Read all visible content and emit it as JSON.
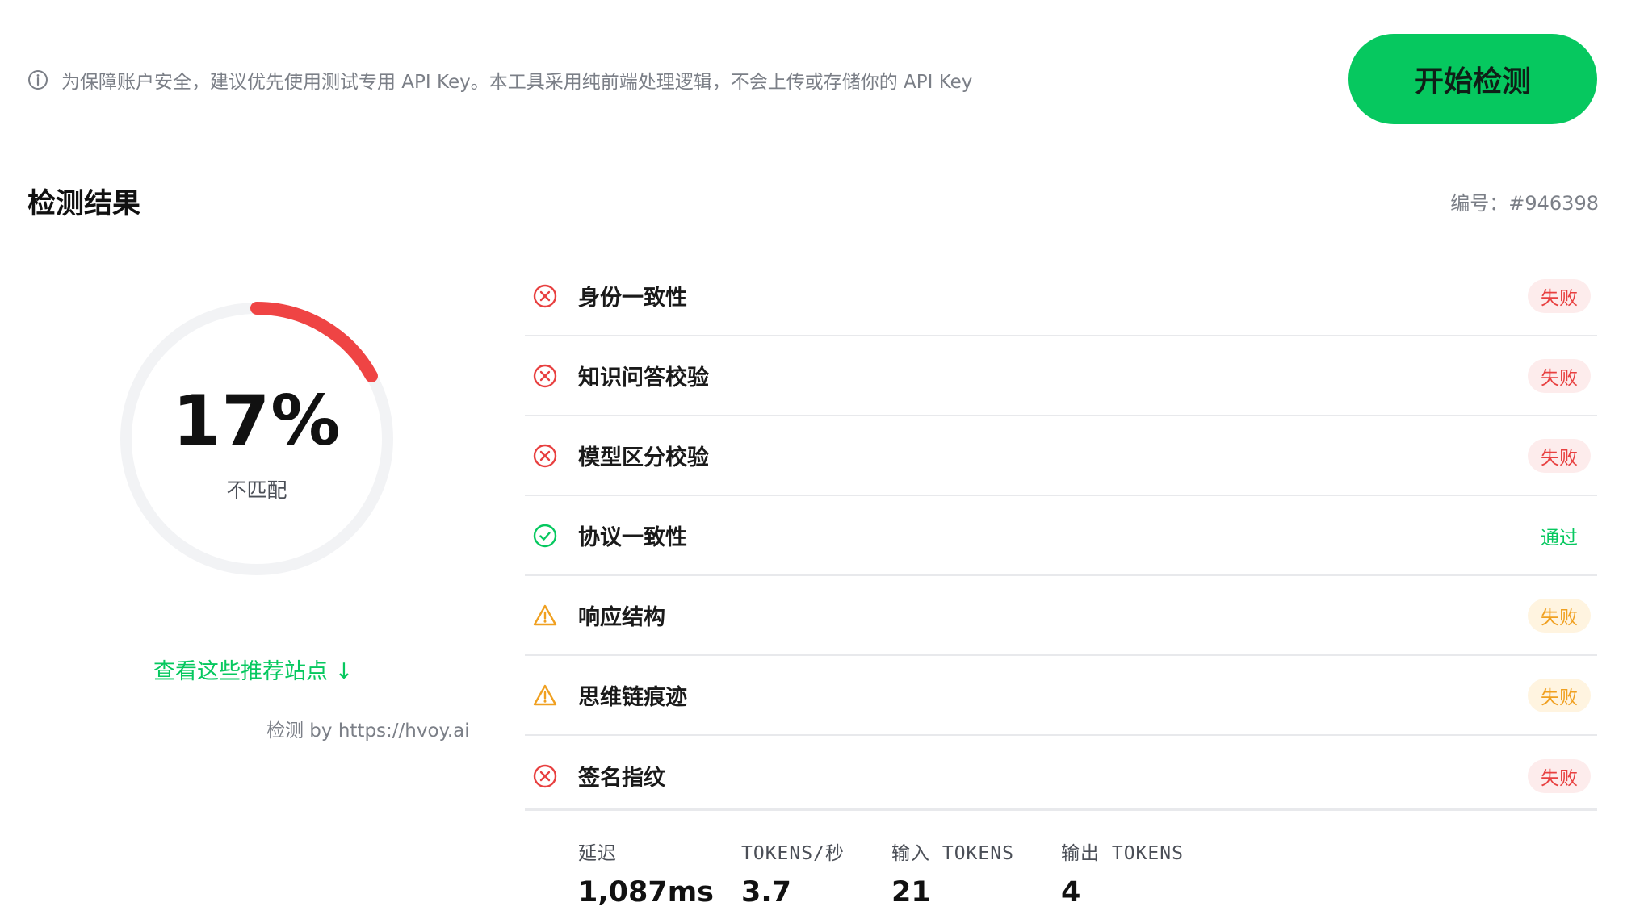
{
  "notice": {
    "icon": "info-icon",
    "text": "为保障账户安全，建议优先使用测试专用 API Key。本工具采用纯前端处理逻辑，不会上传或存储你的 API Key"
  },
  "start_button": {
    "label": "开始检测",
    "color": "#06c85f"
  },
  "results": {
    "title": "检测结果",
    "serial": "编号：#946398"
  },
  "score": {
    "value": "17%",
    "fraction": 0.17,
    "label": "不匹配",
    "arc_color": "#ef4444",
    "track_color": "#f2f3f5"
  },
  "recommend_link": "查看这些推荐站点 ↓",
  "credit": "检测 by https://hvoy.ai",
  "checks": [
    {
      "label": "身份一致性",
      "status": "失败",
      "kind": "fail",
      "icon": "x-circle-icon"
    },
    {
      "label": "知识问答校验",
      "status": "失败",
      "kind": "fail",
      "icon": "x-circle-icon"
    },
    {
      "label": "模型区分校验",
      "status": "失败",
      "kind": "fail",
      "icon": "x-circle-icon"
    },
    {
      "label": "协议一致性",
      "status": "通过",
      "kind": "pass",
      "icon": "check-circle-icon"
    },
    {
      "label": "响应结构",
      "status": "失败",
      "kind": "warn",
      "icon": "warning-triangle-icon"
    },
    {
      "label": "思维链痕迹",
      "status": "失败",
      "kind": "warn",
      "icon": "warning-triangle-icon"
    },
    {
      "label": "签名指纹",
      "status": "失败",
      "kind": "fail",
      "icon": "x-circle-icon"
    }
  ],
  "stats": [
    {
      "label": "延迟",
      "value": "1,087ms"
    },
    {
      "label": "TOKENS/秒",
      "value": "3.7"
    },
    {
      "label": "输入 TOKENS",
      "value": "21"
    },
    {
      "label": "输出 TOKENS",
      "value": "4"
    }
  ],
  "colors": {
    "fail": "#e84040",
    "warn": "#f0a020",
    "pass": "#06c85f"
  }
}
